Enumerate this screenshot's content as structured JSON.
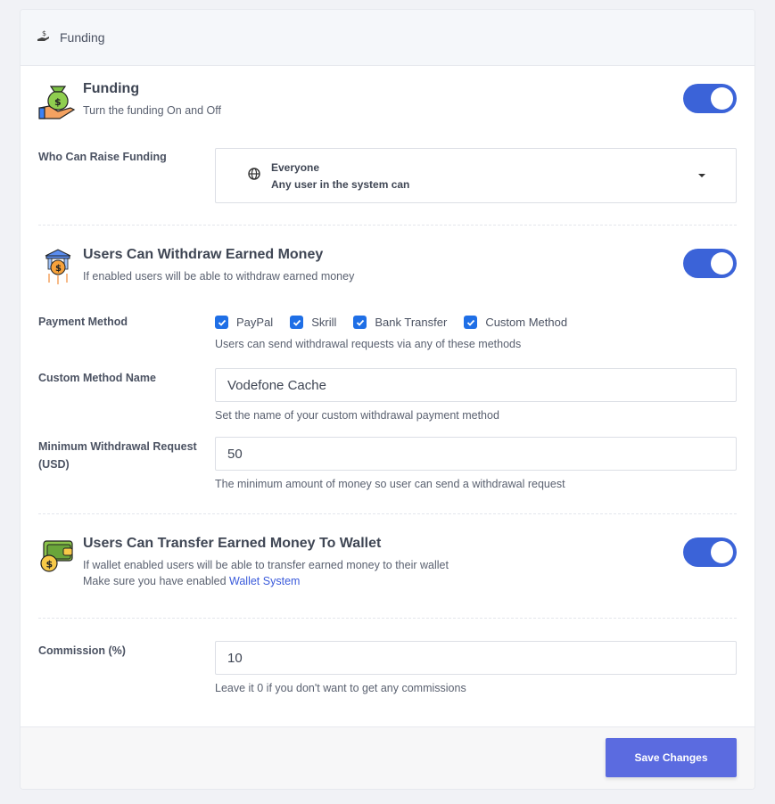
{
  "header": {
    "title": "Funding",
    "icon": "hand-dollar-icon"
  },
  "funding": {
    "title": "Funding",
    "description": "Turn the funding On and Off",
    "enabled": true,
    "icon": "money-bag-hand-icon"
  },
  "who_can_raise": {
    "label": "Who Can Raise Funding",
    "selected_title": "Everyone",
    "selected_sub": "Any user in the system can",
    "icon": "globe-icon"
  },
  "withdraw": {
    "title": "Users Can Withdraw Earned Money",
    "description": "If enabled users will be able to withdraw earned money",
    "enabled": true,
    "icon": "bank-coin-icon"
  },
  "payment_method": {
    "label": "Payment Method",
    "options": [
      {
        "label": "PayPal",
        "checked": true
      },
      {
        "label": "Skrill",
        "checked": true
      },
      {
        "label": "Bank Transfer",
        "checked": true
      },
      {
        "label": "Custom Method",
        "checked": true
      }
    ],
    "help": "Users can send withdrawal requests via any of these methods"
  },
  "custom_method": {
    "label": "Custom Method Name",
    "value": "Vodefone Cache",
    "help": "Set the name of your custom withdrawal payment method"
  },
  "min_withdrawal": {
    "label": "Minimum Withdrawal Request (USD)",
    "value": "50",
    "help": "The minimum amount of money so user can send a withdrawal request"
  },
  "transfer": {
    "title": "Users Can Transfer Earned Money To Wallet",
    "description": "If wallet enabled users will be able to transfer earned money to their wallet",
    "note_prefix": "Make sure you have enabled",
    "link_text": "Wallet System",
    "enabled": true,
    "icon": "wallet-coin-icon"
  },
  "commission": {
    "label": "Commission (%)",
    "value": "10",
    "help": "Leave it 0 if you don't want to get any commissions"
  },
  "footer": {
    "save_label": "Save Changes"
  },
  "colors": {
    "toggle": "#3b63d8",
    "button": "#5b6be0",
    "checkbox": "#1f6fe6",
    "link": "#3b5bdb"
  }
}
